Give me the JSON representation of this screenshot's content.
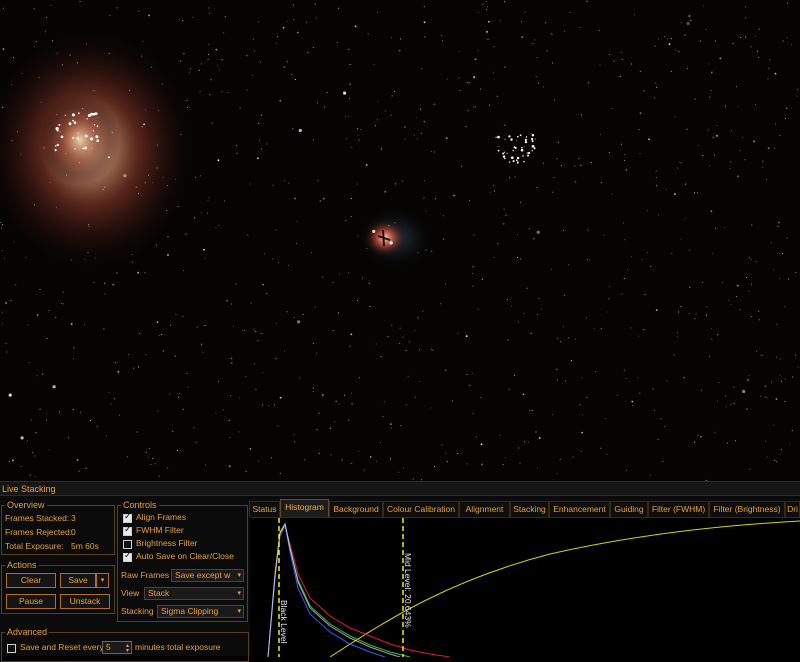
{
  "window": {
    "title": "Live Stacking"
  },
  "overview": {
    "legend": "Overview",
    "frames_stacked_label": "Frames Stacked:",
    "frames_stacked_value": "3",
    "frames_rejected_label": "Frames Rejected:",
    "frames_rejected_value": "0",
    "total_exposure_label": "Total Exposure:",
    "total_exposure_value": "5m 60s"
  },
  "actions": {
    "legend": "Actions",
    "clear": "Clear",
    "save": "Save",
    "pause": "Pause",
    "unstack": "Unstack"
  },
  "controls": {
    "legend": "Controls",
    "align_frames": {
      "label": "Align Frames",
      "checked": true
    },
    "fwhm_filter": {
      "label": "FWHM Filter",
      "checked": true
    },
    "brightness_filter": {
      "label": "Brightness Filter",
      "checked": false
    },
    "auto_save": {
      "label": "Auto Save on Clear/Close",
      "checked": true
    },
    "raw_frames_label": "Raw Frames",
    "raw_frames_value": "Save except w",
    "view_label": "View",
    "view_value": "Stack",
    "stacking_label": "Stacking",
    "stacking_value": "Sigma Clipping"
  },
  "advanced": {
    "legend": "Advanced",
    "save_reset_label": "Save and Reset every",
    "save_reset_checked": false,
    "minutes_value": "5",
    "minutes_suffix": "minutes total exposure"
  },
  "tabs": [
    "Status",
    "Histogram",
    "Background",
    "Colour Calibration",
    "Alignment",
    "Stacking",
    "Enhancement",
    "Guiding",
    "Filter (FWHM)",
    "Filter (Brightness)",
    "Dri"
  ],
  "active_tab": "Histogram",
  "histogram": {
    "black_level_label": "Black Level",
    "mid_level_label": "Mid Level: 20.643%"
  },
  "colors": {
    "accent": "#e8a040",
    "red_channel": "#e02020",
    "green_channel": "#30c040",
    "blue_channel": "#3060ff",
    "curve": "#d8d020",
    "level_marker": "#f0f020"
  }
}
